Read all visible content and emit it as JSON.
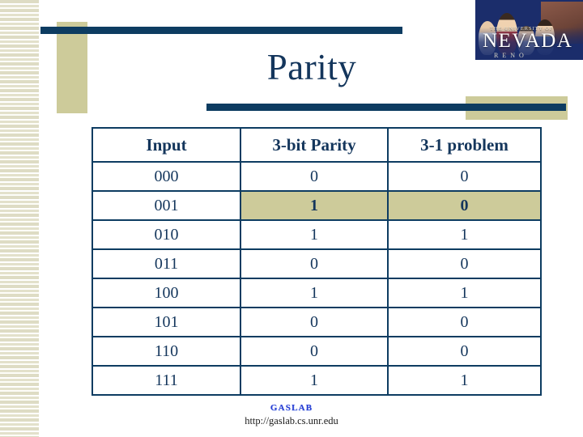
{
  "slide": {
    "title": "Parity"
  },
  "logo": {
    "university_line": "THE UNIVERSITY OF",
    "name": "NEVADA",
    "campus": "RENO"
  },
  "table": {
    "headers": [
      "Input",
      "3-bit Parity",
      "3-1 problem"
    ],
    "rows": [
      {
        "input": "000",
        "parity": "0",
        "problem": "0",
        "highlight": false
      },
      {
        "input": "001",
        "parity": "1",
        "problem": "0",
        "highlight": true
      },
      {
        "input": "010",
        "parity": "1",
        "problem": "1",
        "highlight": false
      },
      {
        "input": "011",
        "parity": "0",
        "problem": "0",
        "highlight": false
      },
      {
        "input": "100",
        "parity": "1",
        "problem": "1",
        "highlight": false
      },
      {
        "input": "101",
        "parity": "0",
        "problem": "0",
        "highlight": false
      },
      {
        "input": "110",
        "parity": "0",
        "problem": "0",
        "highlight": false
      },
      {
        "input": "111",
        "parity": "1",
        "problem": "1",
        "highlight": false
      }
    ]
  },
  "footer": {
    "lab_logo_text": "GASLAB",
    "url": "http://gaslab.cs.unr.edu"
  },
  "colors": {
    "navy": "#0d3c61",
    "title_navy": "#14365c",
    "tan": "#cdcb9a",
    "stripe_beige": "#dedcc4",
    "logo_blue": "#1b2d6b",
    "gaslab_blue": "#2a3fd4"
  }
}
